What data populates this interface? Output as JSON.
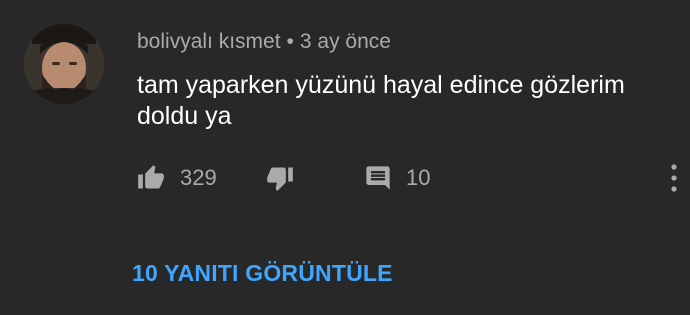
{
  "comment": {
    "author": "bolivyalı kısmet",
    "separator": "•",
    "time": "3 ay önce",
    "text": "tam yaparken yüzünü hayal edince gözlerim doldu ya",
    "avatar_icon": "person-avatar",
    "actions": {
      "like_icon": "thumb-up-icon",
      "like_count": "329",
      "dislike_icon": "thumb-down-icon",
      "reply_icon": "comment-icon",
      "reply_count": "10",
      "more_icon": "more-vertical-icon"
    },
    "view_replies_label": "10 YANITI GÖRÜNTÜLE"
  },
  "colors": {
    "background": "#282828",
    "meta_text": "#aaaaaa",
    "accent_link": "#3ea6ff"
  }
}
